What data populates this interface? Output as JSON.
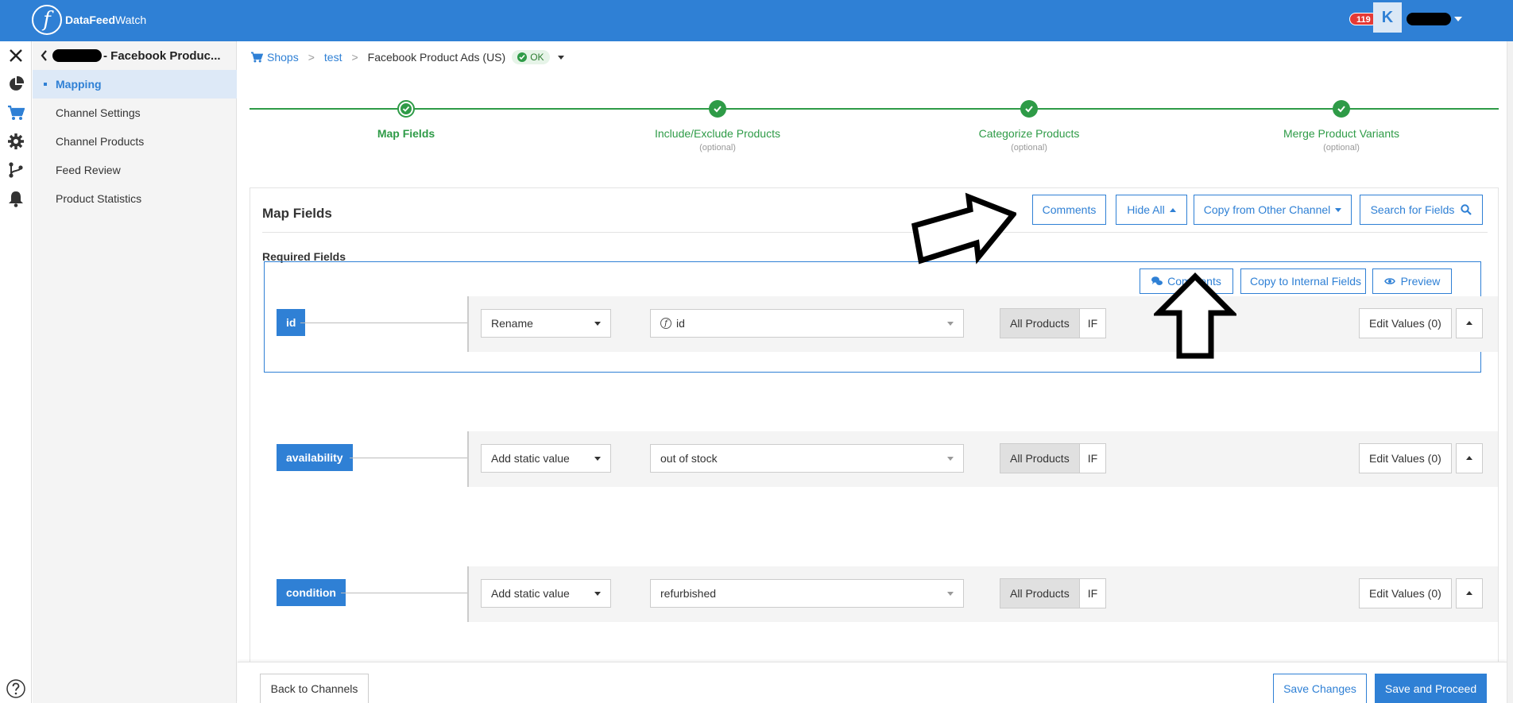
{
  "app": {
    "logo_letter": "f",
    "brand_bold": "DataFeed",
    "brand_light": "Watch"
  },
  "header": {
    "notification_count": "119",
    "avatar_initial": "K"
  },
  "sidebar": {
    "title": "- Facebook Produc...",
    "items": [
      {
        "label": "Mapping",
        "active": true
      },
      {
        "label": "Channel Settings"
      },
      {
        "label": "Channel Products"
      },
      {
        "label": "Feed Review"
      },
      {
        "label": "Product Statistics"
      }
    ]
  },
  "breadcrumb": {
    "shops": "Shops",
    "shop": "test",
    "channel": "Facebook Product Ads (US)",
    "status": "OK"
  },
  "steps": [
    {
      "label": "Map Fields",
      "optional": ""
    },
    {
      "label": "Include/Exclude Products",
      "optional": "(optional)"
    },
    {
      "label": "Categorize Products",
      "optional": "(optional)"
    },
    {
      "label": "Merge Product Variants",
      "optional": "(optional)"
    }
  ],
  "panel": {
    "title": "Map Fields",
    "required_label": "Required Fields",
    "toolbar": {
      "comments": "Comments",
      "hide_all": "Hide All",
      "copy_from": "Copy from Other Channel",
      "search": "Search for Fields"
    },
    "field_toolbar": {
      "comments": "Comments",
      "copy_internal": "Copy to Internal Fields",
      "preview": "Preview"
    },
    "rows": [
      {
        "name": "id",
        "method": "Rename",
        "value": "id",
        "scope": "All Products",
        "if": "IF",
        "edit": "Edit Values (0)"
      },
      {
        "name": "availability",
        "method": "Add static value",
        "value": "out of stock",
        "scope": "All Products",
        "if": "IF",
        "edit": "Edit Values (0)"
      },
      {
        "name": "condition",
        "method": "Add static value",
        "value": "refurbished",
        "scope": "All Products",
        "if": "IF",
        "edit": "Edit Values (0)"
      }
    ]
  },
  "footer": {
    "back": "Back to Channels",
    "save": "Save Changes",
    "proceed": "Save and Proceed"
  },
  "colors": {
    "primary": "#2f80d5",
    "success": "#2e9b47",
    "danger": "#e53935"
  }
}
